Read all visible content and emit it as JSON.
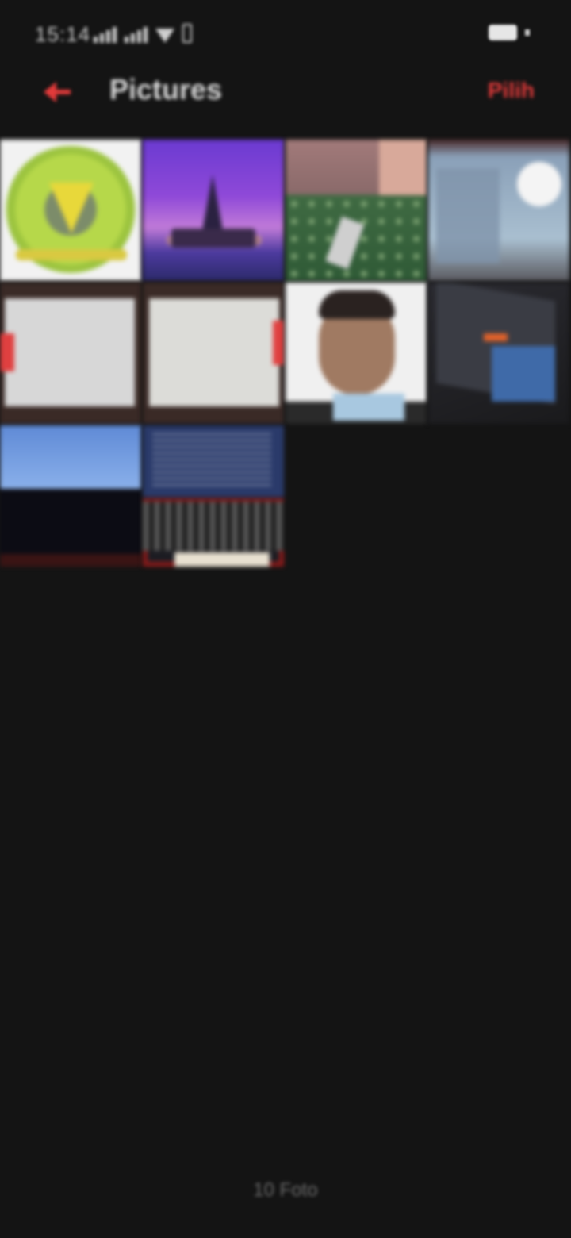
{
  "status_bar": {
    "time": "15:14",
    "network_icon": "signal-bars-icon",
    "wifi_icon": "wifi-icon",
    "extra_icon": "phone-icon",
    "battery_icon": "battery-icon"
  },
  "header": {
    "back_icon": "back-arrow-icon",
    "title": "Pictures",
    "action_label": "Pilih",
    "accent_color": "#e23a3a"
  },
  "gallery": {
    "columns": 4,
    "thumbnails": [
      {
        "subject": "emblem"
      },
      {
        "subject": "temple-at-dusk"
      },
      {
        "subject": "green-pattern"
      },
      {
        "subject": "document-photo"
      },
      {
        "subject": "paper-document"
      },
      {
        "subject": "paper-document"
      },
      {
        "subject": "portrait-with-id-card"
      },
      {
        "subject": "screen-photo"
      },
      {
        "subject": "laptop-screen"
      },
      {
        "subject": "laptop-code"
      }
    ]
  },
  "footer": {
    "count_text": "10 Foto"
  }
}
